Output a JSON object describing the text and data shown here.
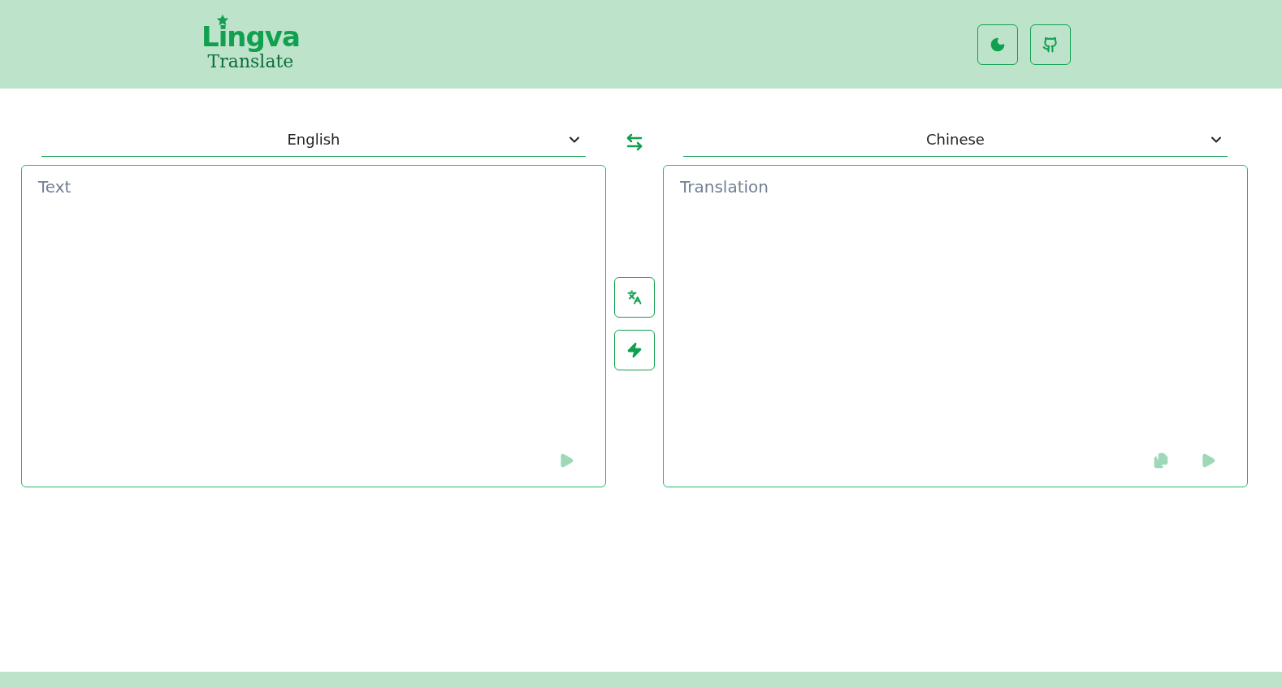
{
  "header": {
    "logo": {
      "title": "Lingva",
      "subtitle": "Translate"
    }
  },
  "source": {
    "language": "English",
    "placeholder": "Text",
    "play_disabled": true
  },
  "target": {
    "language": "Chinese",
    "placeholder": "Translation",
    "copy_disabled": true,
    "play_disabled": true
  }
}
